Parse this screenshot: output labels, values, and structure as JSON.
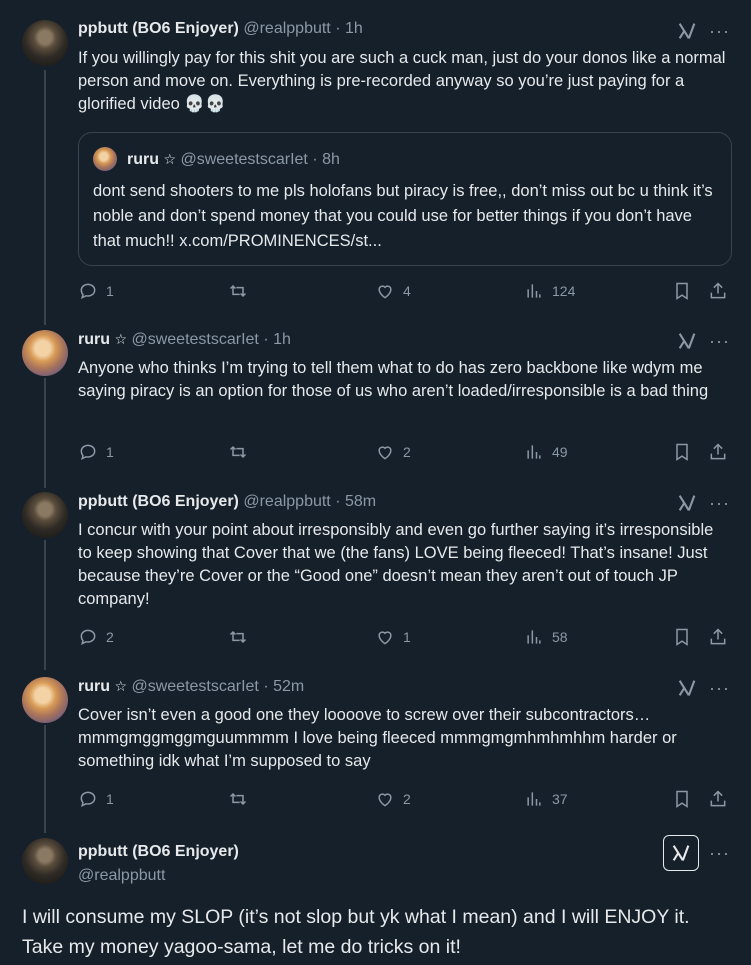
{
  "tweets": [
    {
      "name": "ppbutt (BO6 Enjoyer)",
      "handle": "@realppbutt",
      "time": "1h",
      "text": "If you willingly pay for this shit you are such a cuck man, just do your donos like a normal person and move on. Everything is pre-recorded anyway so you’re just paying for a glorified video 💀💀",
      "quote": {
        "name": "ruru",
        "handle": "@sweetestscarIet",
        "time": "8h",
        "text": "dont send shooters to me pls holofans but piracy is free,, don’t miss out bc u think it’s noble and don’t spend money that you could use for better things if you don’t have that much!! x.com/PROMINENCES/st..."
      },
      "replies": "1",
      "retweets": "",
      "likes": "4",
      "views": "124"
    },
    {
      "name": "ruru",
      "handle": "@sweetestscarIet",
      "time": "1h",
      "text": "Anyone who thinks I’m trying to tell them what to do has zero backbone like wdym me saying piracy is an option for those of us who aren’t loaded/irresponsible is a bad thing",
      "replies": "1",
      "retweets": "",
      "likes": "2",
      "views": "49"
    },
    {
      "name": "ppbutt (BO6 Enjoyer)",
      "handle": "@realppbutt",
      "time": "58m",
      "text": "I concur with your point about irresponsibly and even go further saying it’s irresponsible to keep showing that Cover that we (the fans) LOVE being fleeced! That’s insane! Just because they’re Cover or the “Good one” doesn’t mean they aren’t out of touch JP company!",
      "replies": "2",
      "retweets": "",
      "likes": "1",
      "views": "58"
    },
    {
      "name": "ruru",
      "handle": "@sweetestscarIet",
      "time": "52m",
      "text": "Cover isn’t even a good one they loooove to screw over their subcontractors… mmmgmggmggmguummmm I love being fleeced mmmgmgmhmhmhhm harder or something idk what I’m supposed to say",
      "replies": "1",
      "retweets": "",
      "likes": "2",
      "views": "37"
    }
  ],
  "focal": {
    "name": "ppbutt (BO6 Enjoyer)",
    "handle": "@realppbutt",
    "text": "I will consume my SLOP (it’s not slop but yk what I mean) and I will ENJOY it. Take my money yagoo-sama, let me do tricks on it!"
  },
  "separator": " · ",
  "star": "☆",
  "more_glyph": "···"
}
